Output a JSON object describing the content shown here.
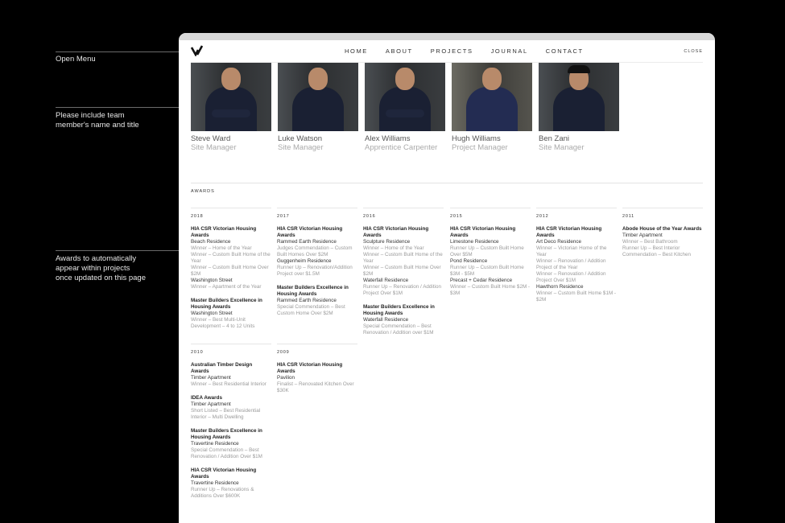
{
  "annotations": [
    "Open Menu",
    "Please include team member's name and title",
    "Awards to automatically appear within projects once updated on this page"
  ],
  "nav": {
    "items": [
      "HOME",
      "ABOUT",
      "PROJECTS",
      "JOURNAL",
      "CONTACT"
    ],
    "close": "CLOSE"
  },
  "team": [
    {
      "name": "Steve Ward",
      "title": "Site Manager"
    },
    {
      "name": "Luke Watson",
      "title": "Site Manager"
    },
    {
      "name": "Alex Williams",
      "title": "Apprentice Carpenter"
    },
    {
      "name": "Hugh Williams",
      "title": "Project Manager"
    },
    {
      "name": "Ben Zani",
      "title": "Site Manager"
    }
  ],
  "awards_heading": "AWARDS",
  "years": [
    {
      "year": "2018",
      "awards": [
        {
          "title": "HIA CSR Victorian Housing Awards",
          "entries": [
            {
              "project": "Beach Residence",
              "results": [
                "Winner – Home of the Year",
                "Winner – Custom Built Home of the Year",
                "Winner – Custom Built Home Over $2M"
              ]
            },
            {
              "project": "Washington Street",
              "results": [
                "Winner – Apartment of the Year"
              ]
            }
          ]
        },
        {
          "title": "Master Builders Excellence in Housing Awards",
          "entries": [
            {
              "project": "Washington Street",
              "results": [
                "Winner – Best Multi-Unit Development – 4 to 12 Units"
              ]
            }
          ]
        }
      ]
    },
    {
      "year": "2017",
      "awards": [
        {
          "title": "HIA CSR Victorian Housing Awards",
          "entries": [
            {
              "project": "Rammed Earth Residence",
              "results": [
                "Judges Commendation – Custom Built Homes Over $2M"
              ]
            },
            {
              "project": "Guggenheim Residence",
              "results": [
                "Runner Up – Renovation/Addition Project over $1.5M"
              ]
            }
          ]
        },
        {
          "title": "Master Builders Excellence in Housing Awards",
          "entries": [
            {
              "project": "Rammed Earth Residence",
              "results": [
                "Special Commendation – Best Custom Home Over $2M"
              ]
            }
          ]
        }
      ]
    },
    {
      "year": "2016",
      "awards": [
        {
          "title": "HIA CSR Victorian Housing Awards",
          "entries": [
            {
              "project": "Sculpture Residence",
              "results": [
                "Winner – Home of the Year",
                "Winner – Custom Built Home of the Year",
                "Winner – Custom Built Home Over $2M"
              ]
            },
            {
              "project": "Waterfall Residence",
              "results": [
                "Runner Up – Renovation / Addition Project Over $1M"
              ]
            }
          ]
        },
        {
          "title": "Master Builders Excellence in Housing Awards",
          "entries": [
            {
              "project": "Waterfall Residence",
              "results": [
                "Special Commendation – Best Renovation / Addition over $1M"
              ]
            }
          ]
        }
      ]
    },
    {
      "year": "2015",
      "awards": [
        {
          "title": "HIA CSR Victorian Housing Awards",
          "entries": [
            {
              "project": "Limestone Residence",
              "results": [
                "Runner Up – Custom Built Home Over $5M"
              ]
            },
            {
              "project": "Pond Residence",
              "results": [
                "Runner Up – Custom Built Home $3M - $5M"
              ]
            },
            {
              "project": "Precast + Cedar Residence",
              "results": [
                "Winner – Custom Built Home $2M - $3M"
              ]
            }
          ]
        }
      ]
    },
    {
      "year": "2012",
      "awards": [
        {
          "title": "HIA CSR Victorian Housing Awards",
          "entries": [
            {
              "project": "Art Deco Residence",
              "results": [
                "Winner – Victorian Home of the Year",
                "Winner – Renovation / Addition Project of the Year",
                "Winner – Renovation / Addition Project Over $1M"
              ]
            },
            {
              "project": "Hawthorn Residence",
              "results": [
                "Winner – Custom Built Home $1M - $2M"
              ]
            }
          ]
        }
      ]
    },
    {
      "year": "2011",
      "awards": [
        {
          "title": "Abode House of the Year Awards",
          "entries": [
            {
              "project": "Timber Apartment",
              "results": [
                "Winner – Best Bathroom",
                "Runner Up – Best Interior",
                "Commendation – Best Kitchen"
              ]
            }
          ]
        }
      ]
    },
    {
      "year": "2010",
      "awards": [
        {
          "title": "Australian Timber Design Awards",
          "entries": [
            {
              "project": "Timber Apartment",
              "results": [
                "Winner – Best Residential Interior"
              ]
            }
          ]
        },
        {
          "title": "IDEA Awards",
          "entries": [
            {
              "project": "Timber Apartment",
              "results": [
                "Short Listed – Best Residential Interior – Multi Dwelling"
              ]
            }
          ]
        },
        {
          "title": "Master Builders Excellence in Housing Awards",
          "entries": [
            {
              "project": "Travertine Residence",
              "results": [
                "Special Commendation – Best Renovation / Addition Over $1M"
              ]
            }
          ]
        },
        {
          "title": "HIA CSR Victorian Housing Awards",
          "entries": [
            {
              "project": "Travertine Residence",
              "results": [
                "Runner Up – Renovations & Additions Over $600K"
              ]
            }
          ]
        }
      ]
    },
    {
      "year": "2009",
      "awards": [
        {
          "title": "HIA CSR Victorian Housing Awards",
          "entries": [
            {
              "project": "Pavilion",
              "results": [
                "Finalist – Renovated Kitchen Over $30K"
              ]
            }
          ]
        }
      ]
    }
  ]
}
